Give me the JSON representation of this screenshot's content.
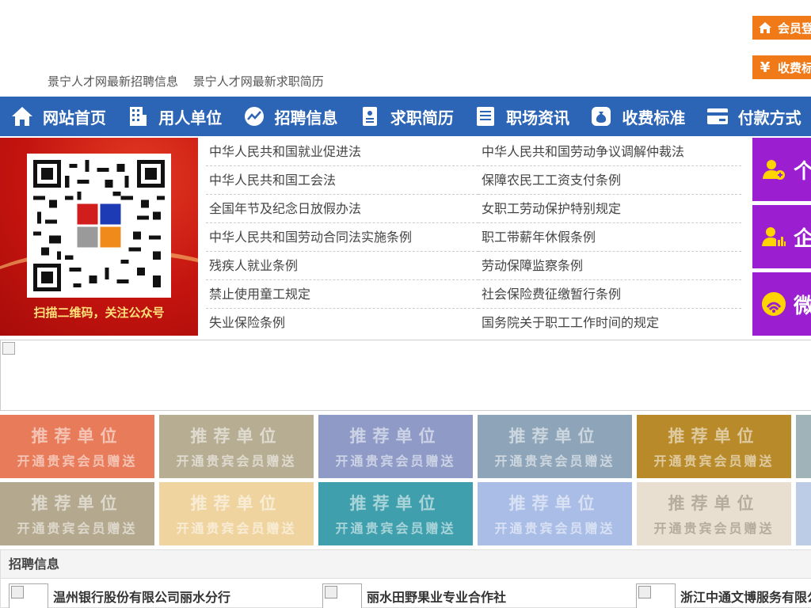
{
  "header": {
    "links": [
      "景宁人才网最新招聘信息",
      "景宁人才网最新求职简历"
    ],
    "member_login": "会员登",
    "fee_standard": "收费标"
  },
  "nav": [
    {
      "label": "网站首页",
      "icon": "home-icon"
    },
    {
      "label": "用人单位",
      "icon": "building-icon"
    },
    {
      "label": "招聘信息",
      "icon": "chart-icon"
    },
    {
      "label": "求职简历",
      "icon": "resume-icon"
    },
    {
      "label": "职场资讯",
      "icon": "news-icon"
    },
    {
      "label": "收费标准",
      "icon": "money-bag-icon"
    },
    {
      "label": "付款方式",
      "icon": "card-icon"
    }
  ],
  "qr": {
    "caption": "扫描二维码，关注公众号"
  },
  "laws": [
    [
      "中华人民共和国就业促进法",
      "中华人民共和国劳动争议调解仲裁法"
    ],
    [
      "中华人民共和国工会法",
      "保障农民工工资支付条例"
    ],
    [
      "全国年节及纪念日放假办法",
      "女职工劳动保护特别规定"
    ],
    [
      "中华人民共和国劳动合同法实施条例",
      "职工带薪年休假条例"
    ],
    [
      "残疾人就业条例",
      "劳动保障监察条例"
    ],
    [
      "禁止使用童工规定",
      "社会保险费征缴暂行条例"
    ],
    [
      "失业保险条例",
      "国务院关于职工工作时间的规定"
    ]
  ],
  "side_buttons": [
    {
      "label": "个",
      "icon": "person-add-icon"
    },
    {
      "label": "企",
      "icon": "company-user-icon"
    },
    {
      "label": "微",
      "icon": "wechat-icon"
    }
  ],
  "tiles": {
    "title": "推荐单位",
    "subtitle": "开通贵宾会员赠送",
    "colors": [
      "#e87b5a",
      "#b6ad93",
      "#8f9bc6",
      "#8ea4b8",
      "#b88a2a",
      "#9fb3b8",
      "#b4a88e",
      "#f0d4a0",
      "#3f9fac",
      "#a9bde6",
      "#e8dfd0",
      "#bccbe6"
    ]
  },
  "recruit": {
    "title": "招聘信息",
    "companies": [
      "温州银行股份有限公司丽水分行",
      "丽水田野果业专业合作社",
      "浙江中通文博服务有限公司"
    ]
  }
}
